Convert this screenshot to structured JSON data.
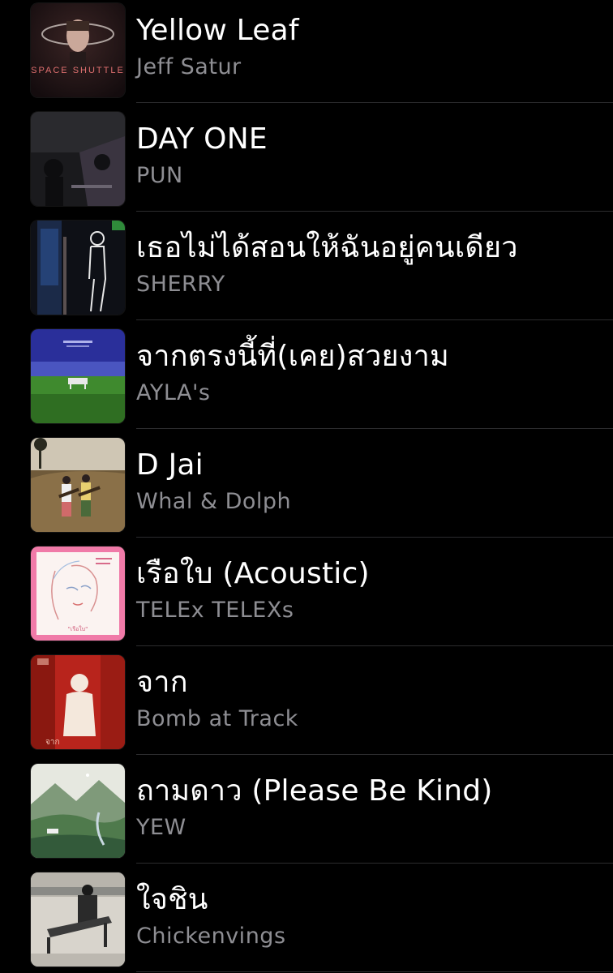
{
  "songs": [
    {
      "title": "Yellow Leaf",
      "artist": "Jeff Satur",
      "artwork": "space-shuttle-artwork",
      "artwork_text": "SPACE SHUTTLE"
    },
    {
      "title": "DAY ONE",
      "artist": "PUN",
      "artwork": "day-one-artwork"
    },
    {
      "title": "เธอไม่ได้สอนให้ฉันอยู่คนเดียว",
      "artist": "SHERRY",
      "artwork": "outline-figure-artwork"
    },
    {
      "title": "จากตรงนี้ที่(เคย)สวยงาม",
      "artist": "AYLA's",
      "artwork": "green-field-artwork"
    },
    {
      "title": "D Jai",
      "artist": "Whal & Dolph",
      "artwork": "duo-guitar-artwork"
    },
    {
      "title": "เรือใบ (Acoustic)",
      "artist": "TELEx TELEXs",
      "artwork": "pink-sketch-artwork",
      "artwork_text": "\"เรือใบ\""
    },
    {
      "title": "จาก",
      "artist": "Bomb at Track",
      "artwork": "red-silhouette-artwork",
      "artwork_text": "จาก"
    },
    {
      "title": "ถามดาว (Please Be Kind)",
      "artist": "YEW",
      "artwork": "mountain-artwork"
    },
    {
      "title": "ใจชิน",
      "artist": "Chickenvings",
      "artwork": "street-bench-artwork"
    }
  ],
  "colors": {
    "background": "#000000",
    "title": "#ffffff",
    "artist": "#8e8e93",
    "divider": "#2c2c2e"
  }
}
